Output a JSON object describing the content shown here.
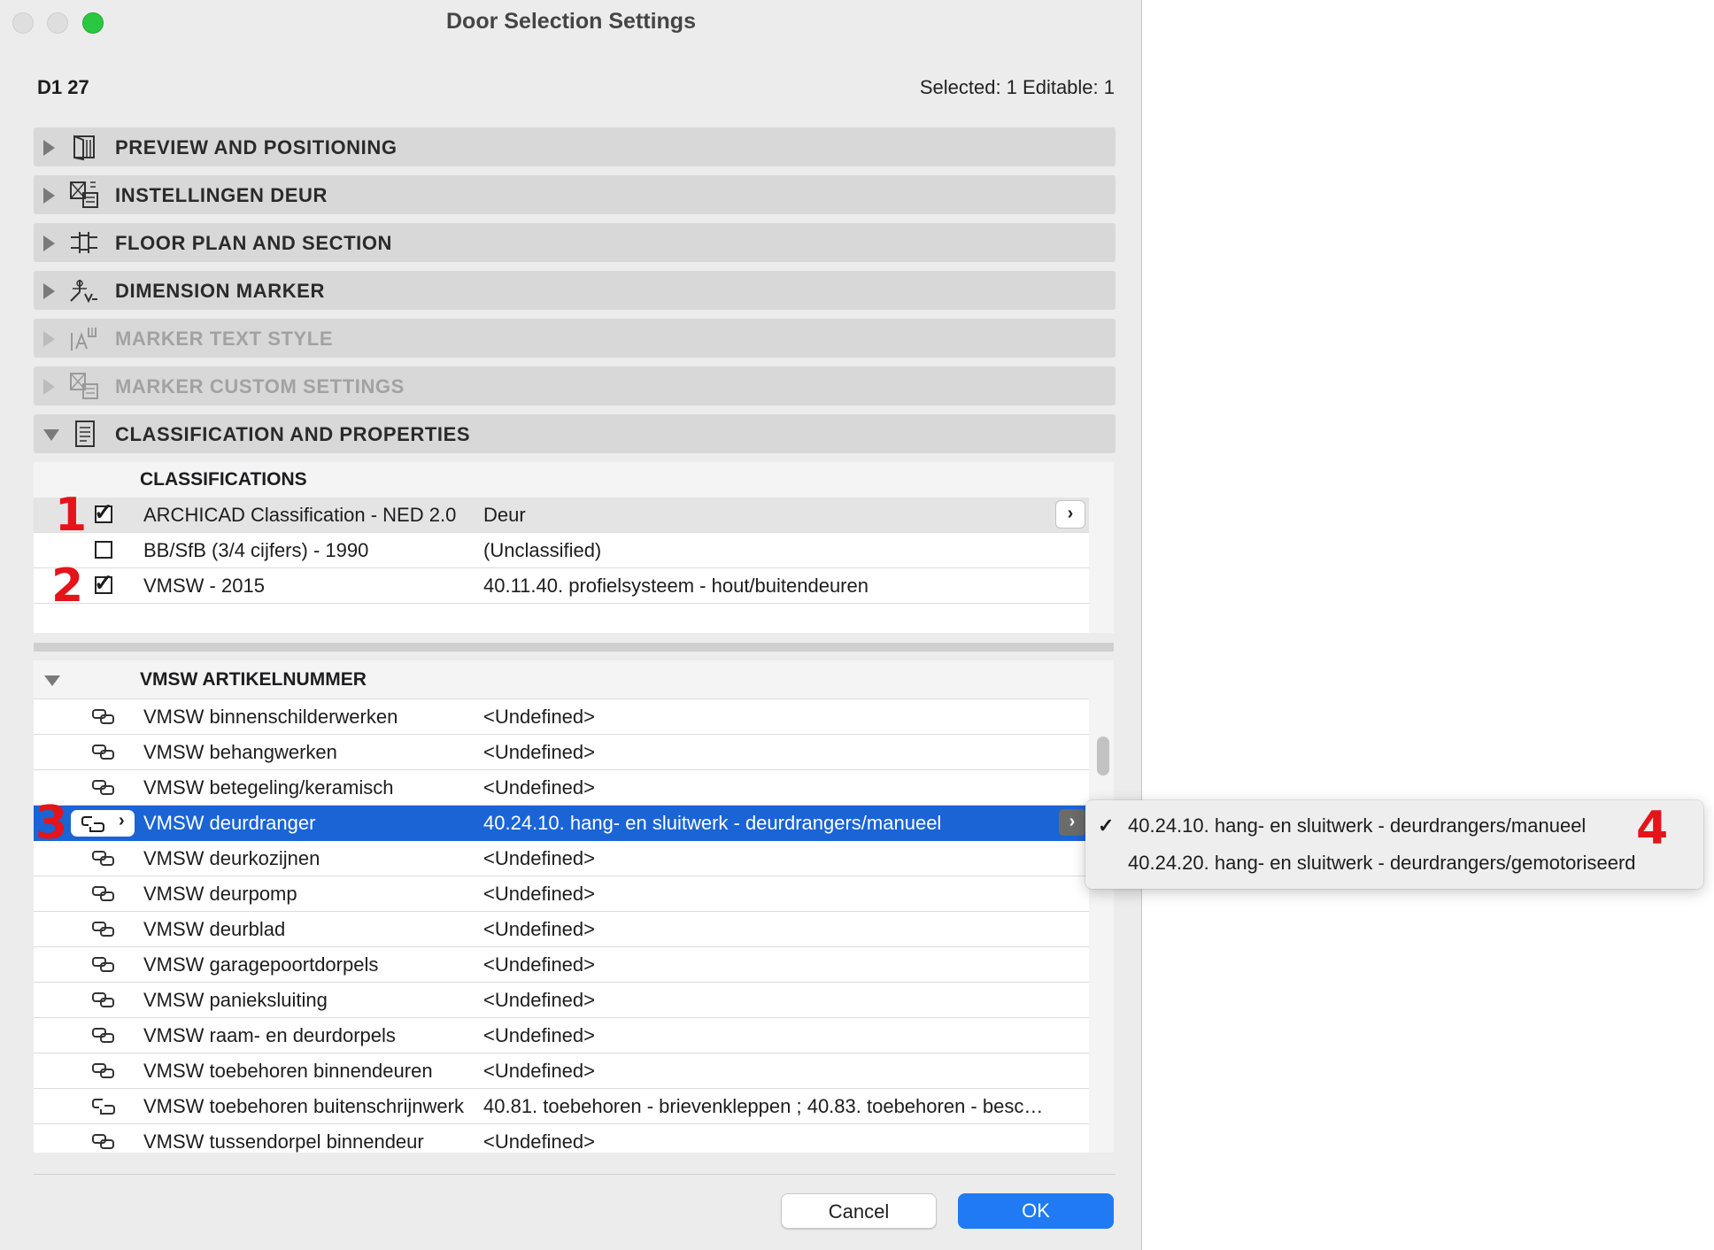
{
  "window": {
    "title": "Door Selection Settings",
    "element_id": "D1 27",
    "selection_status": "Selected: 1 Editable: 1"
  },
  "panels": [
    {
      "label": "PREVIEW AND POSITIONING",
      "icon": "preview-door-icon",
      "expanded": false,
      "enabled": true
    },
    {
      "label": "INSTELLINGEN DEUR",
      "icon": "custom-settings-icon",
      "expanded": false,
      "enabled": true
    },
    {
      "label": "FLOOR PLAN AND SECTION",
      "icon": "floor-plan-icon",
      "expanded": false,
      "enabled": true
    },
    {
      "label": "DIMENSION MARKER",
      "icon": "dimension-marker-icon",
      "expanded": false,
      "enabled": true
    },
    {
      "label": "MARKER TEXT STYLE",
      "icon": "text-style-icon",
      "expanded": false,
      "enabled": false
    },
    {
      "label": "MARKER CUSTOM SETTINGS",
      "icon": "custom-settings-icon",
      "expanded": false,
      "enabled": false
    },
    {
      "label": "CLASSIFICATION AND PROPERTIES",
      "icon": "document-icon",
      "expanded": true,
      "enabled": true
    }
  ],
  "classifications": {
    "header": "CLASSIFICATIONS",
    "rows": [
      {
        "checked": true,
        "name": "ARCHICAD Classification - NED 2.0",
        "value": "Deur"
      },
      {
        "checked": false,
        "name": "BB/SfB (3/4 cijfers) - 1990",
        "value": "(Unclassified)"
      },
      {
        "checked": true,
        "name": "VMSW - 2015",
        "value": "40.11.40. profielsysteem - hout/buitendeuren"
      }
    ]
  },
  "properties": {
    "group_title": "VMSW ARTIKELNUMMER",
    "rows": [
      {
        "name": "VMSW binnenschilderwerken",
        "value": "<Undefined>",
        "linked": true
      },
      {
        "name": "VMSW behangwerken",
        "value": "<Undefined>",
        "linked": true
      },
      {
        "name": "VMSW betegeling/keramisch",
        "value": "<Undefined>",
        "linked": true
      },
      {
        "name": "VMSW deurdranger",
        "value": "40.24.10. hang- en sluitwerk - deurdrangers/manueel",
        "linked": false,
        "selected": true
      },
      {
        "name": "VMSW deurkozijnen",
        "value": "<Undefined>",
        "linked": true
      },
      {
        "name": "VMSW deurpomp",
        "value": "<Undefined>",
        "linked": true
      },
      {
        "name": "VMSW deurblad",
        "value": "<Undefined>",
        "linked": true
      },
      {
        "name": "VMSW garagepoortdorpels",
        "value": "<Undefined>",
        "linked": true
      },
      {
        "name": "VMSW panieksluiting",
        "value": "<Undefined>",
        "linked": true
      },
      {
        "name": "VMSW raam- en deurdorpels",
        "value": "<Undefined>",
        "linked": true
      },
      {
        "name": "VMSW toebehoren binnendeuren",
        "value": "<Undefined>",
        "linked": true
      },
      {
        "name": "VMSW toebehoren buitenschrijnwerk",
        "value": "40.81. toebehoren - brievenkleppen ; 40.83. toebehoren - besc…",
        "linked": false
      },
      {
        "name": "VMSW tussendorpel binnendeur",
        "value": "<Undefined>",
        "linked": true
      }
    ]
  },
  "dropdown": {
    "options": [
      {
        "label": "40.24.10. hang- en sluitwerk - deurdrangers/manueel",
        "checked": true
      },
      {
        "label": "40.24.20. hang- en sluitwerk - deurdrangers/gemotoriseerd",
        "checked": false
      }
    ],
    "check_glyph": "✓"
  },
  "buttons": {
    "cancel": "Cancel",
    "ok": "OK"
  },
  "annotations": [
    "1",
    "2",
    "3",
    "4"
  ],
  "colors": {
    "selection": "#1a64d6",
    "primary_button": "#1f7af4",
    "annotation": "#e4141a"
  }
}
